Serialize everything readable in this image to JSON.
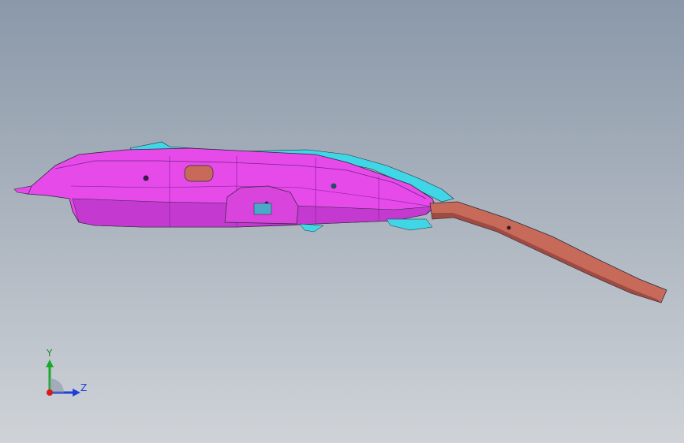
{
  "viewport": {
    "background_top": "#8a98a9",
    "background_bottom": "#cfd3d8"
  },
  "model": {
    "body_color": "#e64ae9",
    "body_shadow": "#b22fc0",
    "trim_color": "#3fd6e6",
    "rail_color": "#c86a5a",
    "rail_shadow": "#8c3f39",
    "outline_color": "#2a2a3a"
  },
  "triad": {
    "y_label": "Y",
    "z_label": "Z",
    "y_color": "#1aa82a",
    "z_color": "#1f3fd8",
    "origin_color": "#d81a1a"
  }
}
